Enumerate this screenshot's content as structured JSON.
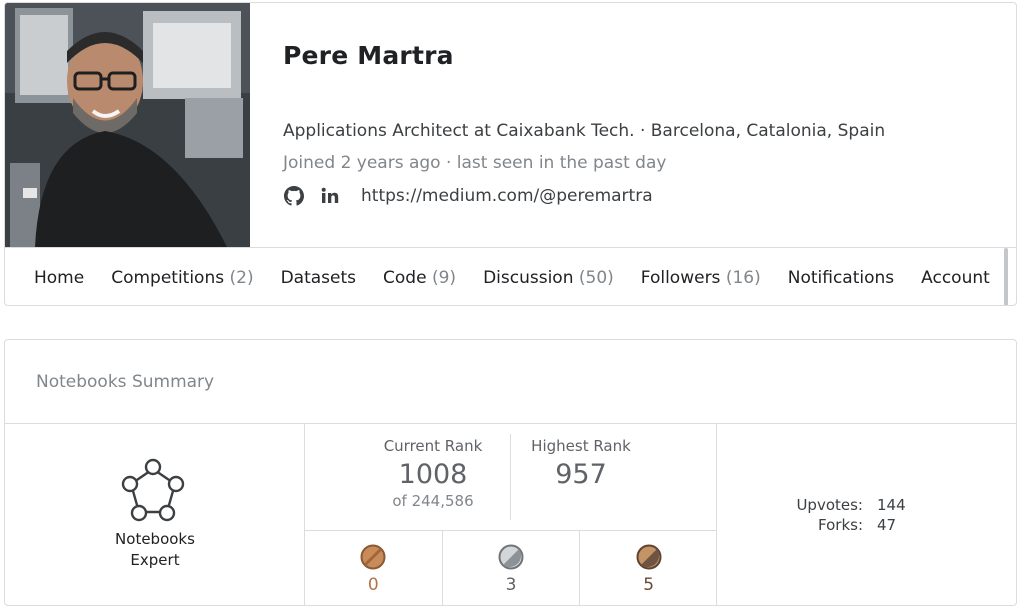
{
  "profile": {
    "name": "Pere Martra",
    "bio": "Applications Architect at Caixabank Tech. · Barcelona, Catalonia, Spain",
    "joined": "Joined 2 years ago · last seen in the past day",
    "links": {
      "github_icon": "github-icon",
      "linkedin_icon": "linkedin-icon",
      "website": "https://medium.com/@peremartra"
    }
  },
  "nav": {
    "items": [
      {
        "label": "Home",
        "count": ""
      },
      {
        "label": "Competitions",
        "count": "(2)"
      },
      {
        "label": "Datasets",
        "count": ""
      },
      {
        "label": "Code",
        "count": "(9)"
      },
      {
        "label": "Discussion",
        "count": "(50)"
      },
      {
        "label": "Followers",
        "count": "(16)"
      },
      {
        "label": "Notifications",
        "count": ""
      },
      {
        "label": "Account",
        "count": ""
      }
    ]
  },
  "summary": {
    "title": "Notebooks Summary",
    "tier": {
      "line1": "Notebooks",
      "line2": "Expert",
      "icon": "notebooks-expert-icon"
    },
    "current_rank": {
      "label": "Current Rank",
      "value": "1008",
      "of": "of 244,586"
    },
    "highest_rank": {
      "label": "Highest Rank",
      "value": "957"
    },
    "medals": [
      {
        "name": "gold",
        "count": "0",
        "color": "#b37546",
        "icon": "gold-medal-icon"
      },
      {
        "name": "silver",
        "count": "3",
        "color": "#5f6368",
        "icon": "silver-medal-icon"
      },
      {
        "name": "bronze",
        "count": "5",
        "color": "#6b4a32",
        "icon": "bronze-medal-icon"
      }
    ],
    "upvotes": {
      "label": "Upvotes:",
      "value": "144"
    },
    "forks": {
      "label": "Forks:",
      "value": "47"
    }
  },
  "colors": {
    "border": "#dadce0",
    "muted": "#80868b",
    "text": "#202124",
    "bronze_medal": "#b37546",
    "silver_medal": "#b8bcbf"
  }
}
